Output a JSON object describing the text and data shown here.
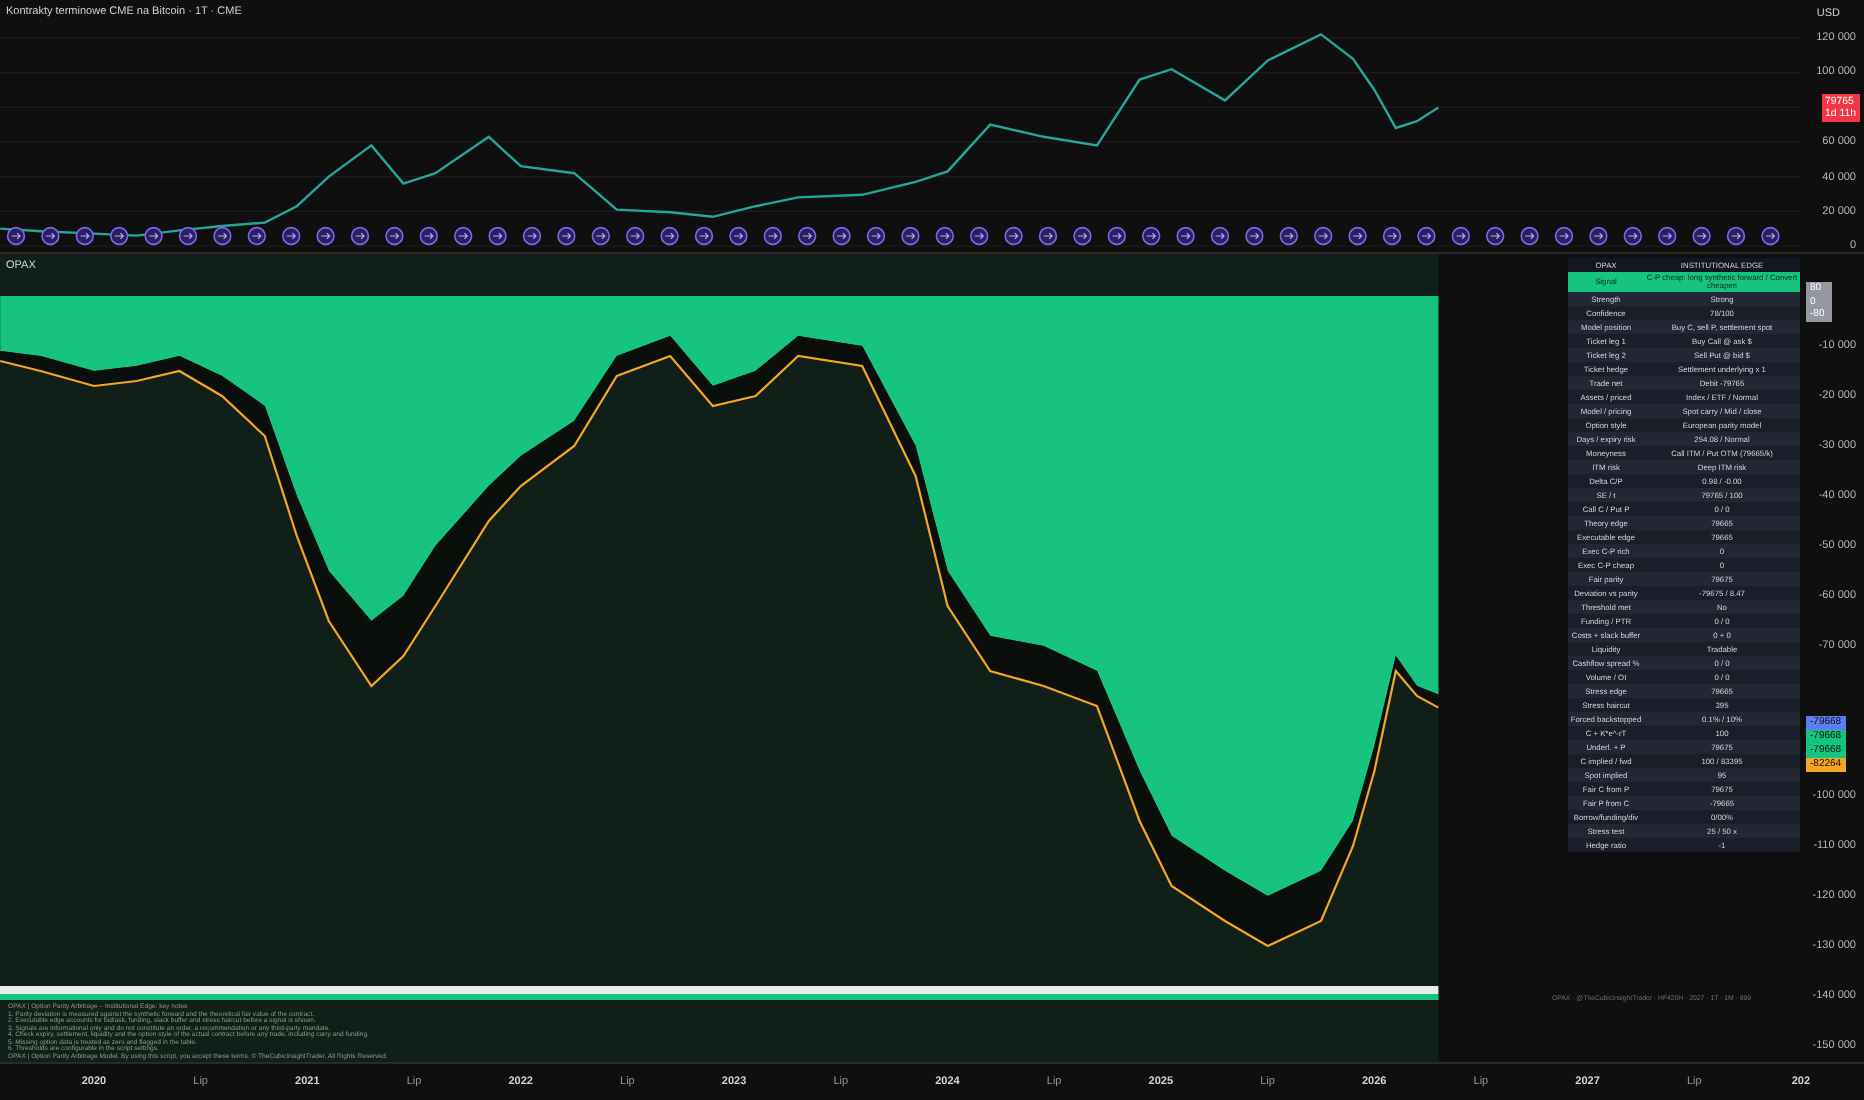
{
  "price_pane": {
    "title": "Kontrakty terminowe CME na Bitcoin · 1T · CME",
    "currency": "USD",
    "last_price": "79765",
    "countdown": "1d 11h",
    "axis_labels": [
      "120 000",
      "100 000",
      "60 000",
      "40 000",
      "20 000",
      "0"
    ]
  },
  "indicator_pane": {
    "title": "OPAX",
    "scale_badges": [
      "80",
      "0",
      "-80"
    ],
    "axis_labels_upper": [
      "-10 000",
      "-20 000",
      "-30 000",
      "-40 000",
      "-50 000",
      "-60 000",
      "-70 000"
    ],
    "axis_labels_lower": [
      "-100 000",
      "-110 000",
      "-120 000",
      "-130 000",
      "-140 000",
      "-150 000"
    ],
    "price_tags": [
      {
        "text": "-79668",
        "color": "#5b7ff0"
      },
      {
        "text": "-79668",
        "color": "#16c47f"
      },
      {
        "text": "-79668",
        "color": "#16c47f"
      },
      {
        "text": "-82264",
        "color": "#f5a623"
      }
    ],
    "table": {
      "header": [
        "OPAX",
        "INSTITUTIONAL EDGE"
      ],
      "signal": {
        "label": "Signal",
        "value": "C-P cheap: long synthetic forward / Convert cheapen"
      },
      "rows": [
        {
          "label": "Strength",
          "value": "Strong"
        },
        {
          "label": "Confidence",
          "value": "78/100"
        },
        {
          "label": "Model position",
          "value": "Buy C, sell P, settlement spot"
        },
        {
          "label": "Ticket leg 1",
          "value": "Buy Call @ ask $"
        },
        {
          "label": "Ticket leg 2",
          "value": "Sell Put @ bid $"
        },
        {
          "label": "Ticket hedge",
          "value": "Settlement underlying x 1"
        },
        {
          "label": "Trade net",
          "value": "Debit -79765"
        },
        {
          "label": "Assets / priced",
          "value": "Index / ETF / Normal"
        },
        {
          "label": "Model / pricing",
          "value": "Spot carry / Mid / close"
        },
        {
          "label": "Option style",
          "value": "European parity model"
        },
        {
          "label": "Days / expiry risk",
          "value": "254.08 / Normal"
        },
        {
          "label": "Moneyness",
          "value": "Call ITM / Put OTM (79665/k)"
        },
        {
          "label": "ITM risk",
          "value": "Deep ITM risk"
        },
        {
          "label": "Delta C/P",
          "value": "0.98 / -0.00"
        },
        {
          "label": "SE / t",
          "value": "79765 / 100"
        },
        {
          "label": "Call C / Put P",
          "value": "0 / 0"
        },
        {
          "label": "Theory edge",
          "value": "79665"
        },
        {
          "label": "Executable edge",
          "value": "79665"
        },
        {
          "label": "Exec C-P rich",
          "value": "0"
        },
        {
          "label": "Exec C-P cheap",
          "value": "0"
        },
        {
          "label": "Fair parity",
          "value": "79675"
        },
        {
          "label": "Deviation vs parity",
          "value": "-79675 / 8.47"
        },
        {
          "label": "Threshold met",
          "value": "No"
        },
        {
          "label": "Funding / PTR",
          "value": "0 / 0"
        },
        {
          "label": "Costs + slack buffer",
          "value": "0 + 0"
        },
        {
          "label": "Liquidity",
          "value": "Tradable"
        },
        {
          "label": "Cashflow spread %",
          "value": "0 / 0"
        },
        {
          "label": "Volume / OI",
          "value": "0 / 0"
        },
        {
          "label": "Stress edge",
          "value": "79665"
        },
        {
          "label": "Stress haircut",
          "value": "395"
        },
        {
          "label": "Forced backstopped",
          "value": "0.1% / 10%"
        },
        {
          "label": "C + K*e^-rT",
          "value": "100"
        },
        {
          "label": "Underl. + P",
          "value": "79675"
        },
        {
          "label": "C implied / fwd",
          "value": "100 / 83395"
        },
        {
          "label": "Spot implied",
          "value": "95"
        },
        {
          "label": "Fair C from P",
          "value": "79675"
        },
        {
          "label": "Fair P from C",
          "value": "-79665"
        },
        {
          "label": "Borrow/funding/div",
          "value": "0/00%"
        },
        {
          "label": "Stress test",
          "value": "25 / 50 x"
        },
        {
          "label": "Hedge ratio",
          "value": "-1"
        }
      ]
    },
    "notes": [
      "OPAX | Option Parity Arbitrage – Institutional Edge: key notes",
      "1. Parity deviation is measured against the synthetic forward and the theoretical fair value of the contract.",
      "2. Executable edge accounts for bid/ask, funding, slack buffer and stress haircut before a signal is shown.",
      "3. Signals are informational only and do not constitute an order, a recommendation or any third-party mandate.",
      "4. Check expiry, settlement, liquidity and the option style of the actual contract before any trade, including carry and funding.",
      "5. Missing option data is treated as zero and flagged in the table.",
      "6. Thresholds are configurable in the script settings.",
      "OPAX | Option Parity Arbitrage Model. By using this script, you accept these terms. © TheCubicInsightTrader, All Rights Reserved."
    ],
    "footer": "OPAX · @TheCubicInsightTrader · HF420H · 2027 · 1T · 1M · 999"
  },
  "time_axis": [
    "2020",
    "Lip",
    "2021",
    "Lip",
    "2022",
    "Lip",
    "2023",
    "Lip",
    "2024",
    "Lip",
    "2025",
    "Lip",
    "2026",
    "Lip",
    "2027",
    "Lip",
    "202"
  ]
}
